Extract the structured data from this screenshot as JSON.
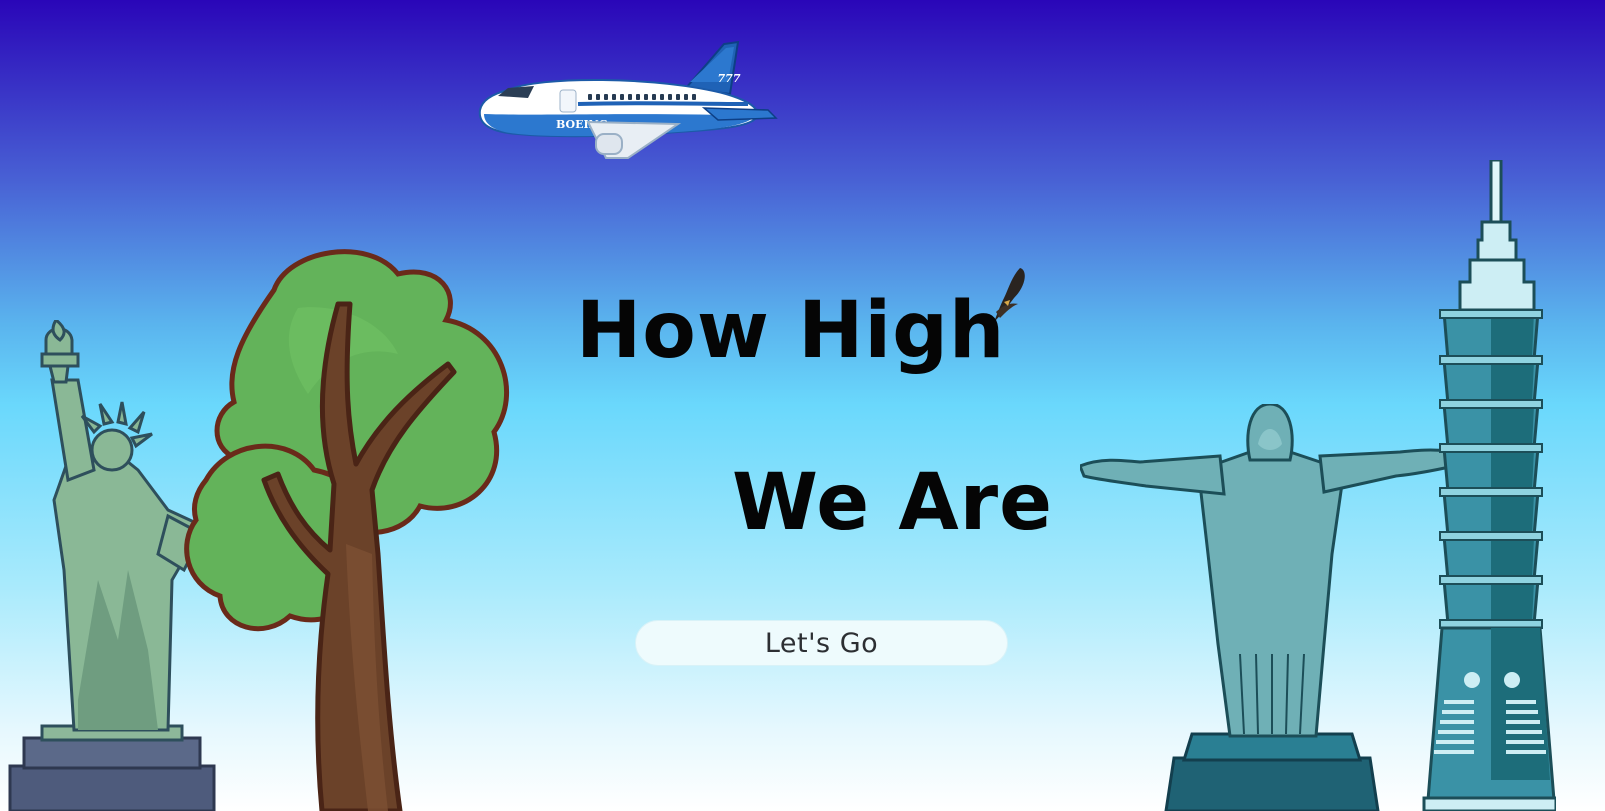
{
  "hero": {
    "line1": "How High",
    "line2": "We Are",
    "cta_label": "Let's Go"
  },
  "airplane": {
    "tail_text": "777",
    "body_text": "BOEING"
  },
  "colors": {
    "sky_top": "#2a06b8",
    "sky_mid": "#6ad8fc",
    "sky_bottom": "#ffffff",
    "tree_leaves": "#63b35a",
    "tree_trunk": "#6b4229",
    "statue_green": "#8ab896",
    "tower_teal": "#3a92a6",
    "heading_text": "#050505"
  },
  "icons": [
    "airplane-icon",
    "bird-icon",
    "statue-of-liberty-icon",
    "tree-icon",
    "christ-the-redeemer-icon",
    "taipei-101-icon"
  ]
}
